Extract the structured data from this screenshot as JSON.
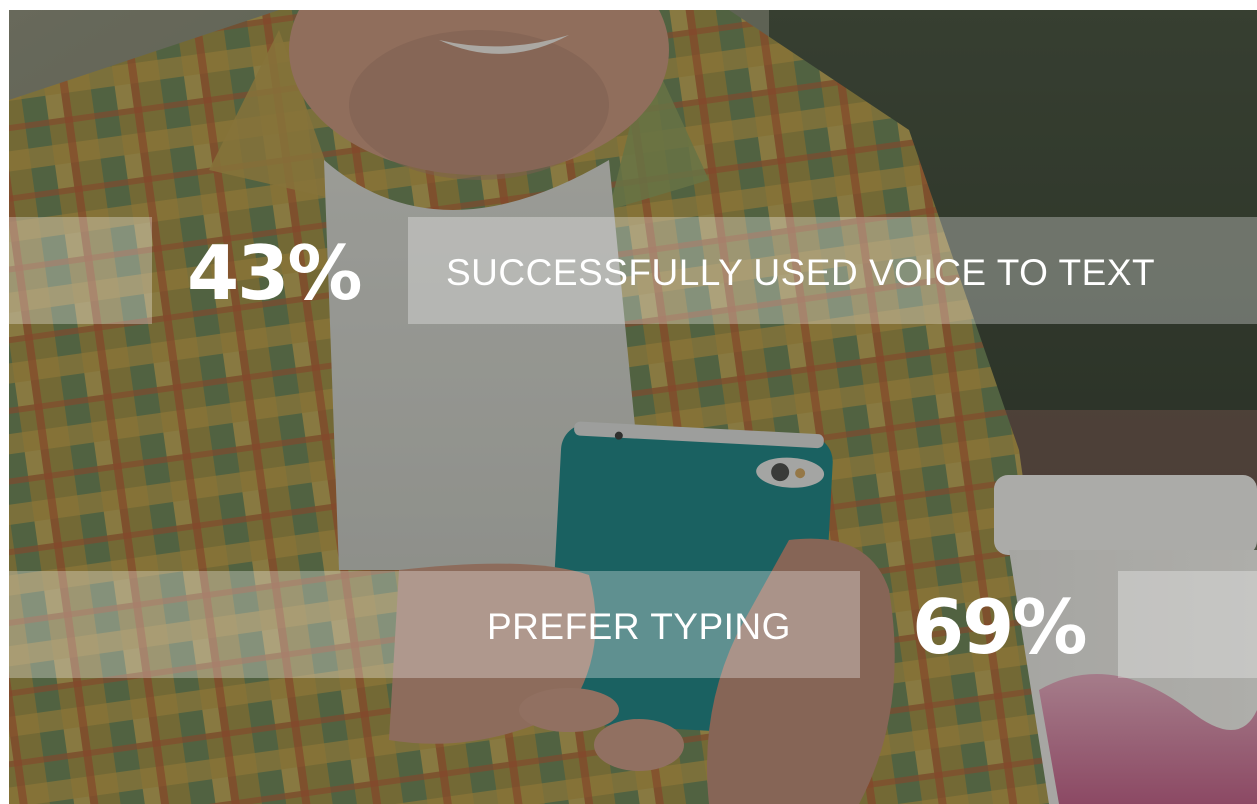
{
  "stats": [
    {
      "value": "43%",
      "label": "SUCCESSFULLY USED VOICE TO TEXT"
    },
    {
      "value": "69%",
      "label": "PREFER TYPING"
    }
  ],
  "colors": {
    "text": "#ffffff",
    "band": "rgba(255,255,255,0.30)",
    "phone_case": "#1a8f91",
    "overlay": "rgba(40,42,38,0.35)"
  },
  "background_photo": "person holding a smartphone next to a paper coffee cup"
}
